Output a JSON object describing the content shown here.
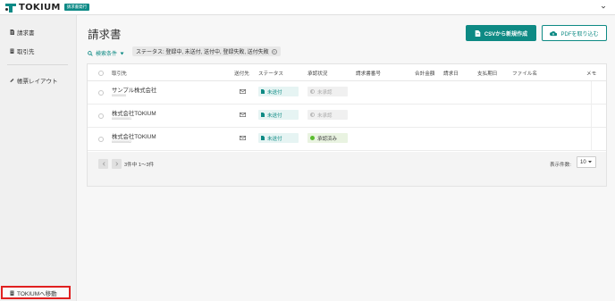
{
  "app": {
    "brand": "TOKIUM",
    "badge": "請求書発行"
  },
  "sidebar": {
    "items": [
      {
        "label": "請求書",
        "icon": "document-icon"
      },
      {
        "label": "取引先",
        "icon": "building-icon"
      },
      {
        "label": "帳票レイアウト",
        "icon": "pencil-icon"
      }
    ],
    "bottom_link": "TOKIUMへ移動"
  },
  "main": {
    "title": "請求書",
    "csv_button": "CSVから新規作成",
    "pdf_button": "PDFを取り込む",
    "filter_toggle": "検索条件",
    "filter_chip": "ステータス: 登録中, 未送付, 送付中, 登録失敗, 送付失敗"
  },
  "table": {
    "headers": {
      "partner": "取引先",
      "send_to": "送付先",
      "status": "ステータス",
      "approval": "承認状況",
      "invoice_no": "請求書番号",
      "total": "合計金額",
      "date": "請求日",
      "due": "支払期日",
      "file": "ファイル名",
      "memo": "メモ"
    },
    "rows": [
      {
        "name": "サンプル株式会社",
        "code": "00000000",
        "status": "未送付",
        "approval": "未承認",
        "approval_state": "pending"
      },
      {
        "name": "株式会社TOKIUM",
        "code": "00000000001",
        "status": "未送付",
        "approval": "未承認",
        "approval_state": "pending"
      },
      {
        "name": "株式会社TOKIUM",
        "code": "00000000002",
        "status": "未送付",
        "approval": "承認済み",
        "approval_state": "done"
      }
    ],
    "page_info": "3件中 1〜3件",
    "per_page_label": "表示件数:",
    "per_page_value": "10"
  },
  "colors": {
    "accent": "#0e8a84",
    "highlight": "#e02020",
    "approved": "#5bbd2f"
  }
}
